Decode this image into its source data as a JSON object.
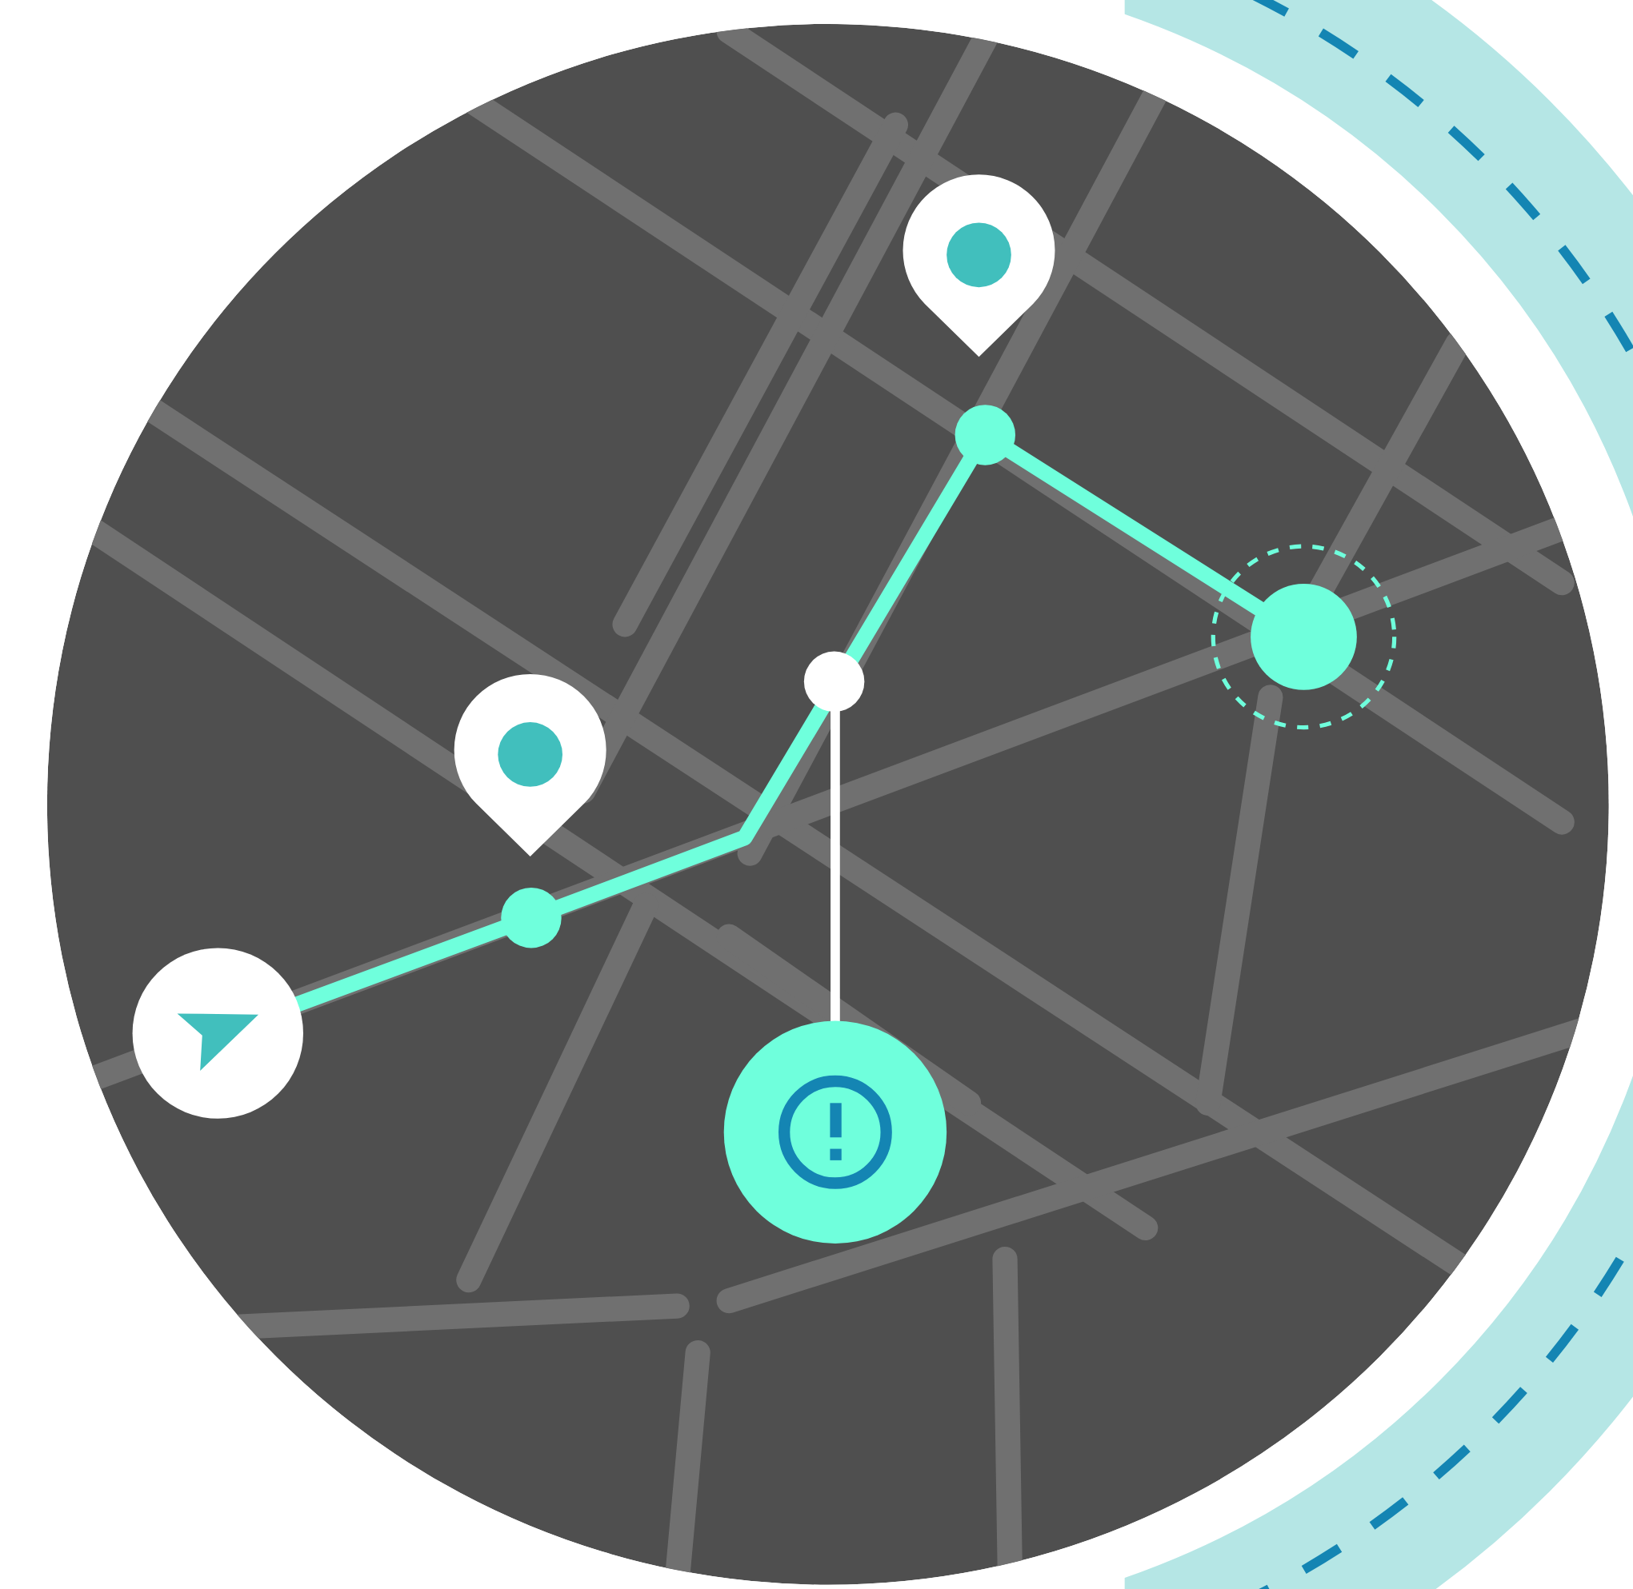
{
  "map": {
    "route_visible": true,
    "markers": [
      {
        "kind": "pin"
      },
      {
        "kind": "pin"
      },
      {
        "kind": "start"
      },
      {
        "kind": "waypoint"
      },
      {
        "kind": "waypoint"
      },
      {
        "kind": "junction"
      },
      {
        "kind": "alert"
      },
      {
        "kind": "target"
      }
    ]
  }
}
